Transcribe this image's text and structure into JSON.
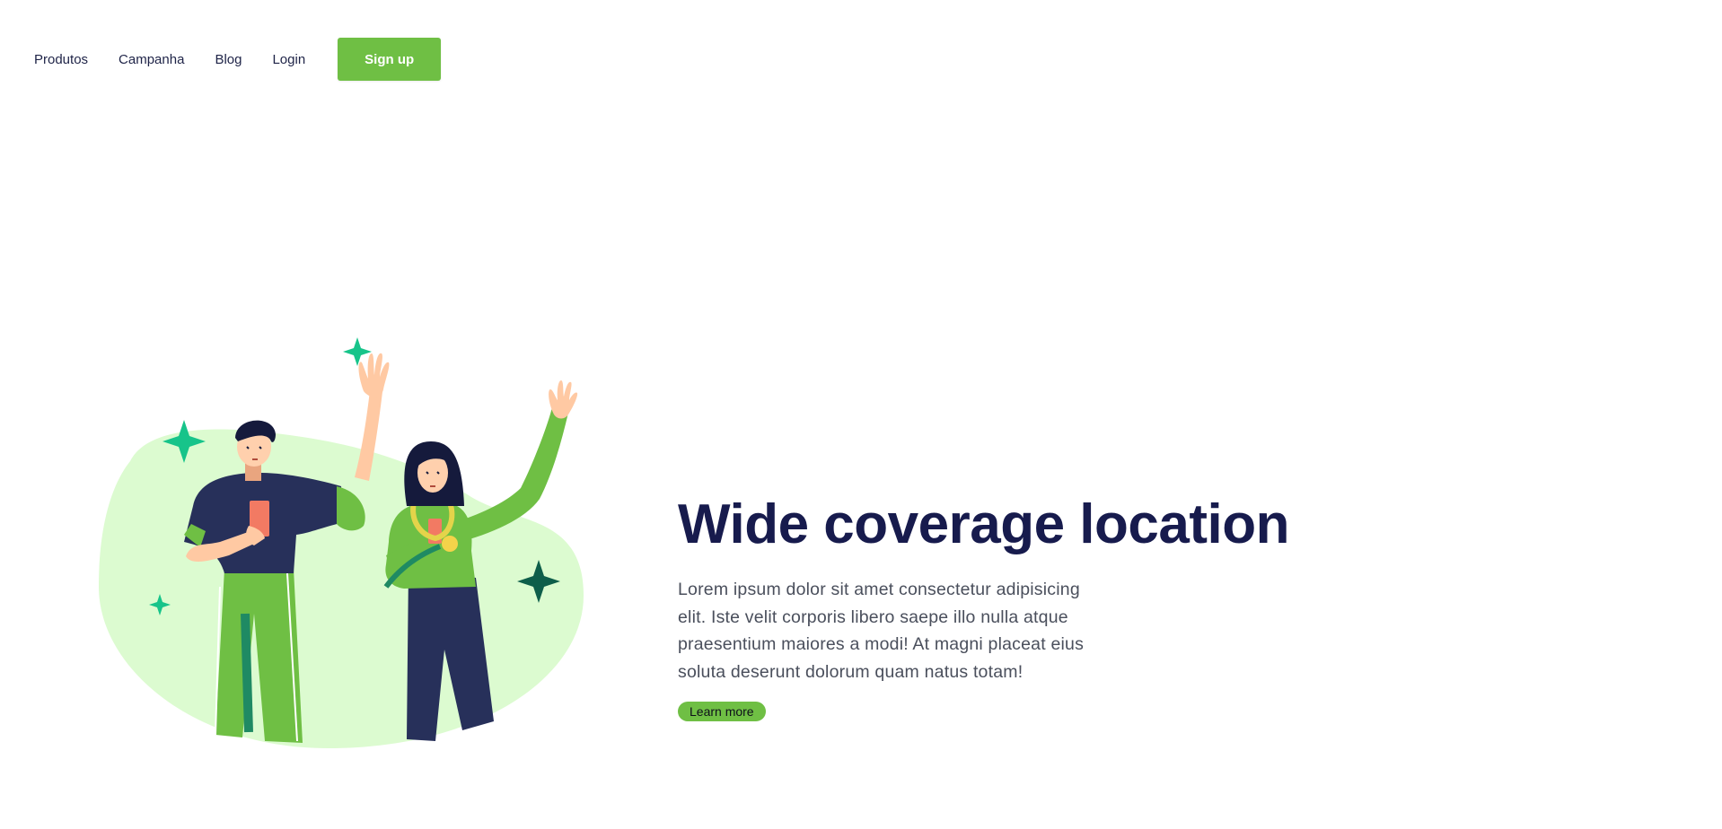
{
  "nav": {
    "items": [
      {
        "label": "Produtos"
      },
      {
        "label": "Campanha"
      },
      {
        "label": "Blog"
      },
      {
        "label": "Login"
      }
    ],
    "signup_label": "Sign up"
  },
  "hero": {
    "title": "Wide coverage location",
    "body": "Lorem ipsum dolor sit amet consectetur adipisicing elit. Iste velit corporis libero saepe illo nulla atque praesentium maiores a modi! At magni placeat eius soluta deserunt dolorum quam natus totam!",
    "cta_label": "Learn more"
  },
  "colors": {
    "accent": "#6fbf44",
    "heading": "#171b4d",
    "blob": "#dcfbd0",
    "sparkle": "#17c48a",
    "sparkle_dark": "#0e5e4a",
    "navy": "#27305a"
  },
  "illustration": {
    "icon": "two-people-waving-illustration"
  }
}
